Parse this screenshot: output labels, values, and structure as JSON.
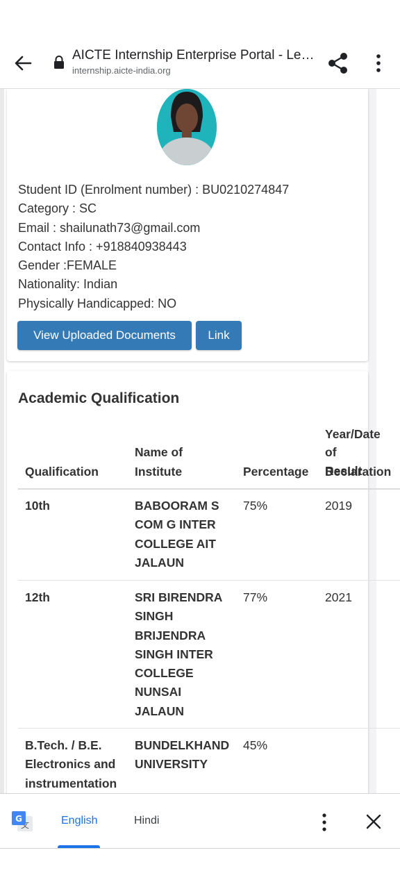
{
  "browser": {
    "page_title": "AICTE Internship Enterprise Portal - Lea…",
    "url": "internship.aicte-india.org"
  },
  "profile": {
    "student_id": "Student ID (Enrolment number) : BU0210274847",
    "category": "Category : SC",
    "email": "Email : shailunath73@gmail.com",
    "contact": "Contact Info : +918840938443",
    "gender": "Gender :FEMALE",
    "nationality": "Nationality: Indian",
    "handicapped": "Physically Handicapped: NO",
    "view_docs_label": "View Uploaded Documents",
    "link_label": "Link"
  },
  "academic": {
    "title": "Academic Qualification",
    "headers": {
      "qualification": "Qualification",
      "institute_1": "Name of",
      "institute_2": "Institute",
      "percentage": "Percentage",
      "year_1": "Year/Date",
      "year_2": "of Result",
      "year_3": "Declaration"
    },
    "rows": [
      {
        "qualification": [
          "10th"
        ],
        "institute": [
          "BABOORAM S",
          "COM G INTER",
          "COLLEGE AIT",
          "JALAUN"
        ],
        "percentage": "75%",
        "year": "2019"
      },
      {
        "qualification": [
          "12th"
        ],
        "institute": [
          "SRI BIRENDRA",
          "SINGH",
          "BRIJENDRA",
          "SINGH INTER",
          "COLLEGE",
          "NUNSAI",
          "JALAUN"
        ],
        "percentage": "77%",
        "year": "2021"
      },
      {
        "qualification": [
          "B.Tech. / B.E.",
          "Electronics and",
          "instrumentation"
        ],
        "institute": [
          "BUNDELKHAND",
          "UNIVERSITY"
        ],
        "percentage": "45%",
        "year": ""
      }
    ]
  },
  "translate_bar": {
    "lang_active": "English",
    "lang_other": "Hindi"
  },
  "colors": {
    "button_blue": "#337ab7",
    "translate_accent": "#1a73e8"
  }
}
